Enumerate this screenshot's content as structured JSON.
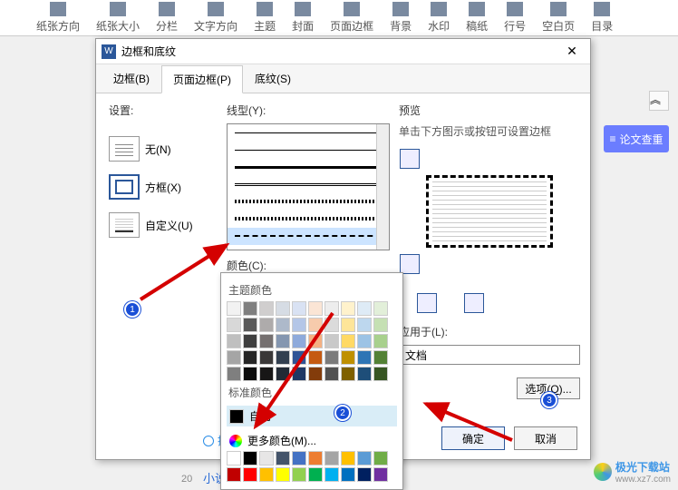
{
  "ribbon": {
    "items": [
      "纸张方向",
      "纸张大小",
      "分栏",
      "文字方向",
      "主题",
      "封面",
      "页面边框",
      "背景",
      "水印",
      "稿纸",
      "行号",
      "空白页",
      "目录"
    ]
  },
  "dialog": {
    "title": "边框和底纹",
    "tabs": {
      "border": "边框(B)",
      "page_border": "页面边框(P)",
      "shading": "底纹(S)"
    },
    "settings": {
      "label": "设置:",
      "none": "无(N)",
      "box": "方框(X)",
      "custom": "自定义(U)"
    },
    "line": {
      "label": "线型(Y):"
    },
    "color": {
      "label": "颜色(C):",
      "value": "自动"
    },
    "preview": {
      "label": "预览",
      "desc": "单击下方图示或按钮可设置边框"
    },
    "apply": {
      "label": "应用于(L):",
      "value": "文档"
    },
    "buttons": {
      "options": "选项",
      "ok": "确定",
      "cancel": "取消"
    },
    "tip": "操作技巧"
  },
  "color_popup": {
    "theme_label": "主题颜色",
    "standard_label": "标准颜色",
    "auto": "自动",
    "more": "更多颜色(M)...",
    "theme_row1": [
      "#ffffff",
      "#000000",
      "#e7e6e6",
      "#44546a",
      "#4472c4",
      "#ed7d31",
      "#a5a5a5",
      "#ffc000",
      "#5b9bd5",
      "#70ad47"
    ],
    "theme_shades": [
      [
        "#f2f2f2",
        "#7f7f7f",
        "#d0cece",
        "#d6dce4",
        "#d9e2f3",
        "#fbe5d5",
        "#ededed",
        "#fff2cc",
        "#deebf6",
        "#e2efd9"
      ],
      [
        "#d8d8d8",
        "#595959",
        "#aeabab",
        "#adb9ca",
        "#b4c6e7",
        "#f7cbac",
        "#dbdbdb",
        "#fee599",
        "#bdd7ee",
        "#c5e0b3"
      ],
      [
        "#bfbfbf",
        "#3f3f3f",
        "#757070",
        "#8496b0",
        "#8eaadb",
        "#f4b183",
        "#c9c9c9",
        "#ffd965",
        "#9cc3e5",
        "#a8d08d"
      ],
      [
        "#a5a5a5",
        "#262626",
        "#3a3838",
        "#323f4f",
        "#2f5496",
        "#c55a11",
        "#7b7b7b",
        "#bf9000",
        "#2e75b5",
        "#538135"
      ],
      [
        "#7f7f7f",
        "#0c0c0c",
        "#171616",
        "#222a35",
        "#1f3864",
        "#833c0b",
        "#525252",
        "#7f6000",
        "#1e4e79",
        "#375623"
      ]
    ],
    "standard": [
      "#c00000",
      "#ff0000",
      "#ffc000",
      "#ffff00",
      "#92d050",
      "#00b050",
      "#00b0f0",
      "#0070c0",
      "#002060",
      "#7030a0"
    ]
  },
  "side": {
    "review": "论文查重"
  },
  "doc": {
    "page_num": "20",
    "bottom_text": "小说"
  },
  "watermark": {
    "name": "极光下载站",
    "url": "www.xz7.com"
  },
  "badges": {
    "b1": "1",
    "b2": "2",
    "b3": "3"
  }
}
